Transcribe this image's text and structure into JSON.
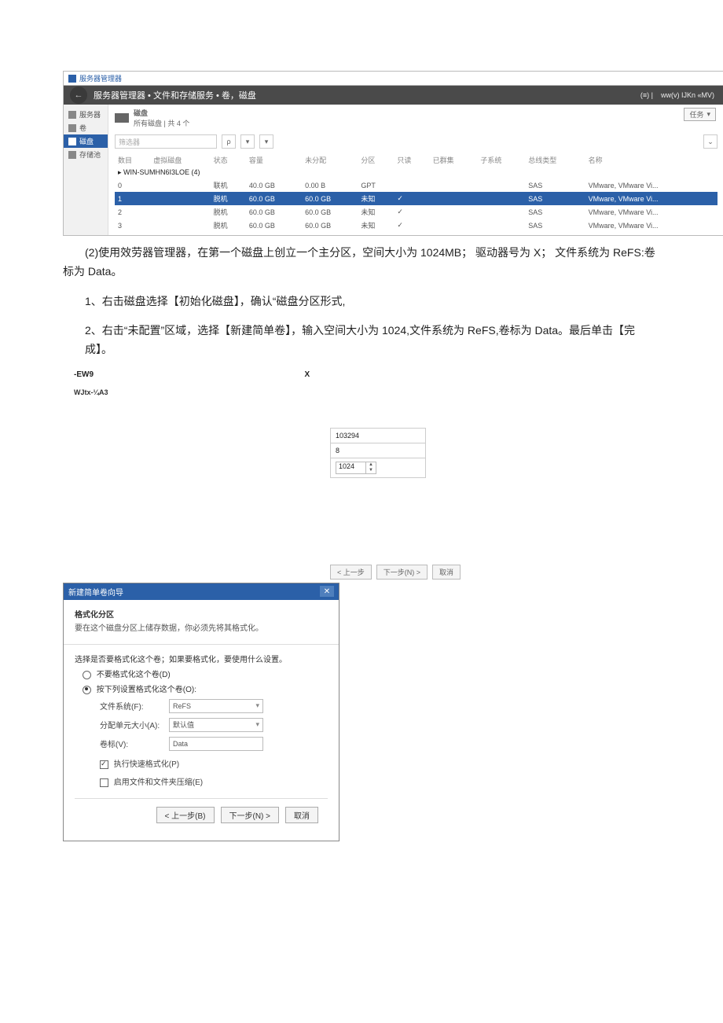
{
  "sm": {
    "app_title": "服务器管理器",
    "breadcrumb": "服务器管理器 • 文件和存储服务 • 卷，磁盘",
    "header_right": {
      "menu_icon": "(≡) |",
      "right": "ww(v) IJKn «MV)"
    },
    "side": {
      "servers": "服务器",
      "volumes": "卷",
      "disks": "磁盘",
      "pools": "存储池"
    },
    "section_title": "磁盘",
    "section_sub": "所有磁盘 | 共 4 个",
    "task_btn": "任务",
    "filter_placeholder": "筛选器",
    "columns": [
      "数目",
      "虚拟磁盘",
      "状态",
      "容量",
      "未分配",
      "分区",
      "只读",
      "已群集",
      "子系统",
      "总线类型",
      "名称"
    ],
    "group": "▸ WIN-SUMHN6I3LOE (4)",
    "rows": [
      {
        "num": "0",
        "status": "联机",
        "cap": "40.0 GB",
        "unalloc": "0.00 B",
        "part": "GPT",
        "ro": "",
        "bus": "SAS",
        "name": "VMware, VMware Vi..."
      },
      {
        "num": "1",
        "status": "脱机",
        "cap": "60.0 GB",
        "unalloc": "60.0 GB",
        "part": "未知",
        "ro": "✓",
        "bus": "SAS",
        "name": "VMware, VMware Vi..."
      },
      {
        "num": "2",
        "status": "脱机",
        "cap": "60.0 GB",
        "unalloc": "60.0 GB",
        "part": "未知",
        "ro": "✓",
        "bus": "SAS",
        "name": "VMware, VMware Vi..."
      },
      {
        "num": "3",
        "status": "脱机",
        "cap": "60.0 GB",
        "unalloc": "60.0 GB",
        "part": "未知",
        "ro": "✓",
        "bus": "SAS",
        "name": "VMware, VMware Vi..."
      }
    ]
  },
  "para2": "(2)使用效劳器管理器，在第一个磁盘上创立一个主分区，空间大小为 1024MB； 驱动器号为 X； 文件系统为 ReFS:卷标为 Data。",
  "step1": "1、右击磁盘选择【初始化磁盘】，确认“磁盘分区形式,",
  "step2": "2、右击“未配置”区域，选择【新建简单卷】，输入空间大小为 1024,文件系统为 ReFS,卷标为 Data。最后单击【完成】。",
  "frag2": {
    "l1": "-EW9",
    "l2": "WJtx-¼A3",
    "x": "X"
  },
  "sizebox": {
    "v1": "103294",
    "v2": "8",
    "v3": "1024"
  },
  "topbtns": {
    "b1": "< 上一步",
    "b2": "下一步(N) >",
    "b3": "取消"
  },
  "wizard": {
    "title": "新建简单卷向导",
    "close": "✕",
    "heading": "格式化分区",
    "sub": "要在这个磁盘分区上储存数据，你必须先将其格式化。",
    "prompt": "选择是否要格式化这个卷；如果要格式化，要使用什么设置。",
    "opt_no": "不要格式化这个卷(D)",
    "opt_yes": "按下列设置格式化这个卷(O):",
    "lbl_fs": "文件系统(F):",
    "val_fs": "ReFS",
    "lbl_au": "分配单元大小(A):",
    "val_au": "默认值",
    "lbl_label": "卷标(V):",
    "val_label": "Data",
    "chk_quick": "执行快速格式化(P)",
    "chk_compress": "启用文件和文件夹压缩(E)",
    "btn_back": "< 上一步(B)",
    "btn_next": "下一步(N) >",
    "btn_cancel": "取消"
  }
}
